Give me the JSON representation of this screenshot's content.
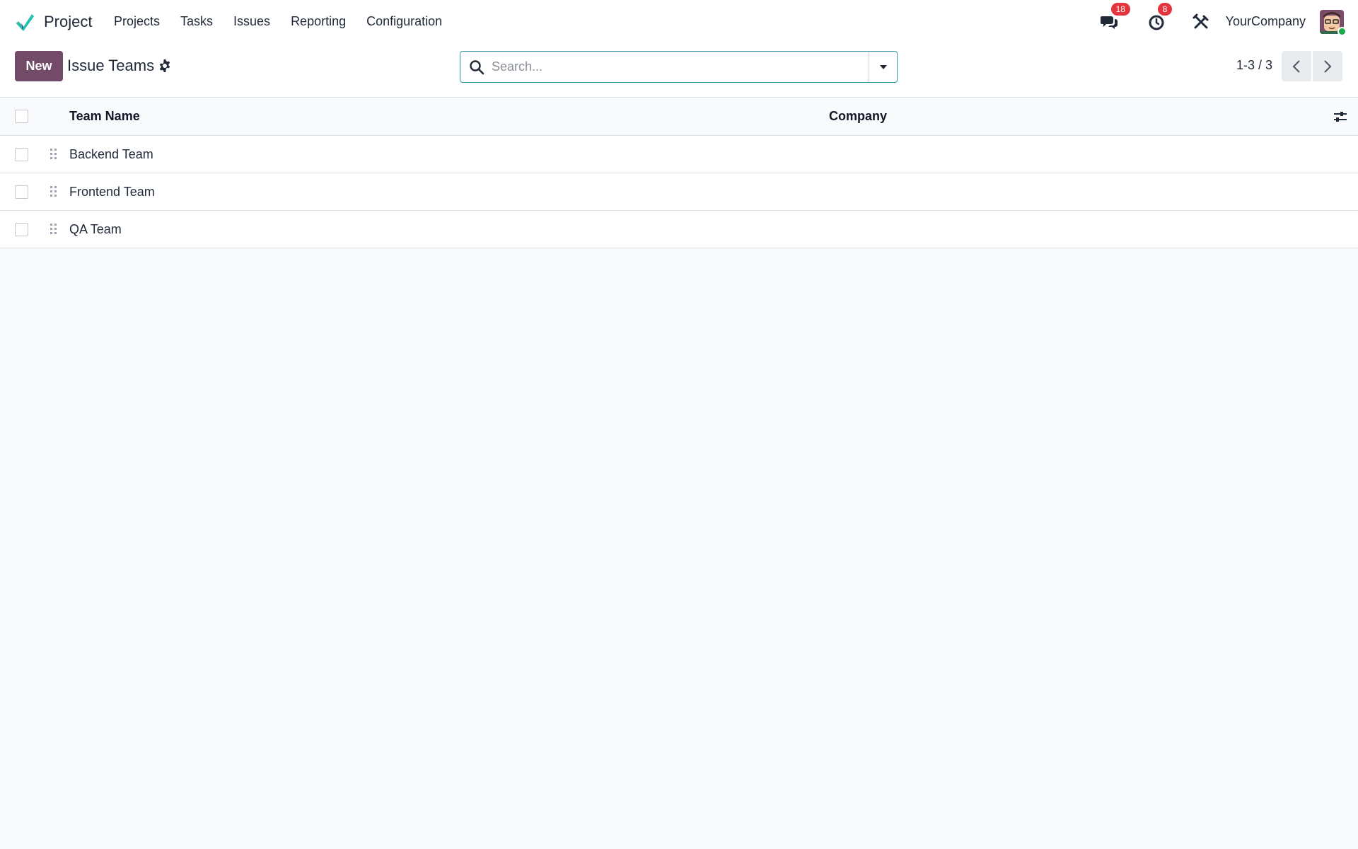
{
  "navbar": {
    "app_name": "Project",
    "menu": [
      {
        "label": "Projects"
      },
      {
        "label": "Tasks"
      },
      {
        "label": "Issues"
      },
      {
        "label": "Reporting"
      },
      {
        "label": "Configuration"
      }
    ],
    "messages_badge": "18",
    "activities_badge": "8",
    "company": "YourCompany",
    "icons": {
      "logo": "project-checkmark-logo",
      "messages": "chat-bubbles-icon",
      "activities": "clock-icon",
      "debug": "tools-icon",
      "avatar": "user-avatar"
    }
  },
  "control_panel": {
    "new_label": "New",
    "title": "Issue Teams",
    "search_placeholder": "Search...",
    "pager": "1-3 / 3"
  },
  "table": {
    "columns": [
      "Team Name",
      "Company"
    ],
    "rows": [
      {
        "name": "Backend Team",
        "company": ""
      },
      {
        "name": "Frontend Team",
        "company": ""
      },
      {
        "name": "QA Team",
        "company": ""
      }
    ]
  },
  "colors": {
    "primary": "#714b67",
    "badge": "#e4343d",
    "search_border": "#2f9aa6",
    "presence": "#18a84a"
  }
}
